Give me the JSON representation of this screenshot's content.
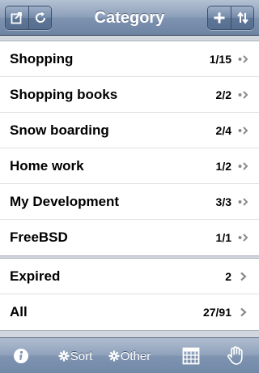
{
  "navbar": {
    "title": "Category",
    "left_buttons": [
      {
        "icon": "export-icon"
      },
      {
        "icon": "refresh-icon"
      }
    ],
    "right_buttons": [
      {
        "icon": "plus-icon"
      },
      {
        "icon": "sort-arrows-icon"
      }
    ]
  },
  "categories": [
    {
      "label": "Shopping",
      "count": "1/15"
    },
    {
      "label": "Shopping books",
      "count": "2/2"
    },
    {
      "label": "Snow boarding",
      "count": "2/4"
    },
    {
      "label": "Home work",
      "count": "1/2"
    },
    {
      "label": "My Development",
      "count": "3/3"
    },
    {
      "label": "FreeBSD",
      "count": "1/1"
    }
  ],
  "summary": [
    {
      "label": "Expired",
      "count": "2"
    },
    {
      "label": "All",
      "count": "27/91"
    }
  ],
  "toolbar": {
    "info_icon": "info-icon",
    "sort_label": "Sort",
    "other_label": "Other",
    "calendar_icon": "calendar-icon",
    "hand_icon": "hand-icon"
  },
  "colors": {
    "bar_blue": "#7e93b0",
    "accessory_gray": "#8a8a8a",
    "section_bg": "#d2d7df"
  }
}
